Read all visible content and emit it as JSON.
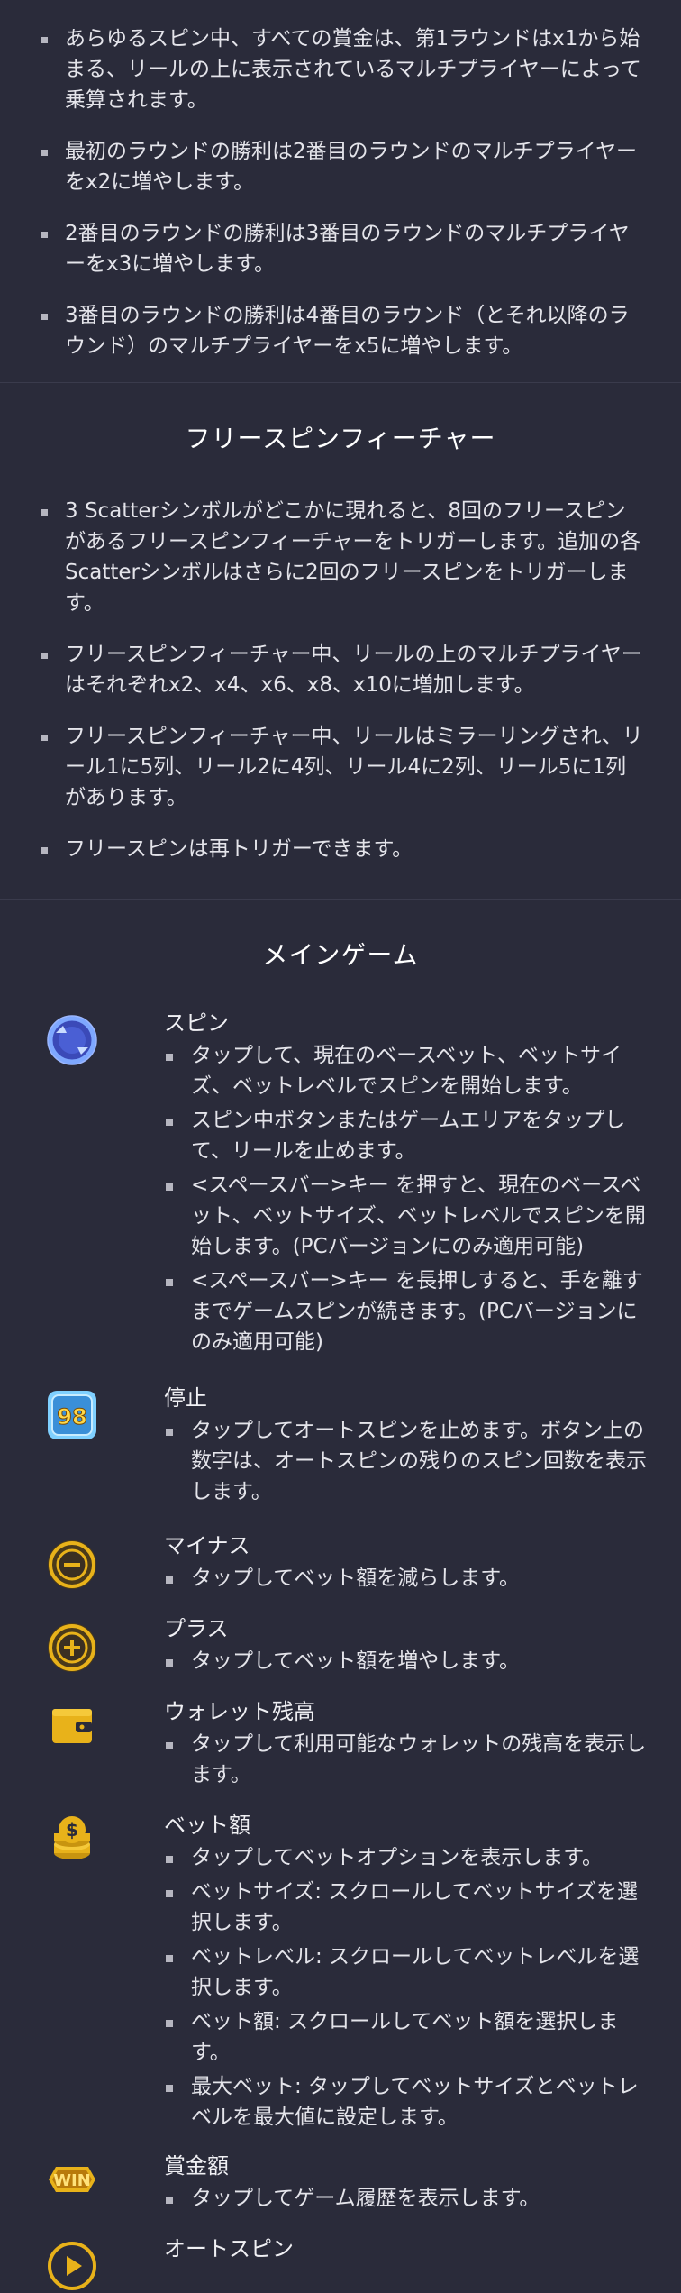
{
  "multiplier_rules": [
    "あらゆるスピン中、すべての賞金は、第1ラウンドはx1から始まる、リールの上に表示されているマルチプライヤーによって乗算されます。",
    "最初のラウンドの勝利は2番目のラウンドのマルチプライヤーをx2に増やします。",
    "2番目のラウンドの勝利は3番目のラウンドのマルチプライヤーをx3に増やします。",
    "3番目のラウンドの勝利は4番目のラウンド（とそれ以降のラウンド）のマルチプライヤーをx5に増やします。"
  ],
  "free_spins": {
    "title": "フリースピンフィーチャー",
    "items": [
      "3 Scatterシンボルがどこかに現れると、8回のフリースピンがあるフリースピンフィーチャーをトリガーします。追加の各Scatterシンボルはさらに2回のフリースピンをトリガーします。",
      "フリースピンフィーチャー中、リールの上のマルチプライヤーはそれぞれx2、x4、x6、x8、x10に増加します。",
      "フリースピンフィーチャー中、リールはミラーリングされ、リール1に5列、リール2に4列、リール4に2列、リール5に1列があります。",
      "フリースピンは再トリガーできます。"
    ]
  },
  "main_game": {
    "title": "メインゲーム",
    "items": [
      {
        "icon": "spin-icon",
        "title": "スピン",
        "bullets": [
          "タップして、現在のベースベット、ベットサイズ、ベットレベルでスピンを開始します。",
          "スピン中ボタンまたはゲームエリアをタップして、リールを止めます。",
          "<スペースバー>キー を押すと、現在のベースベット、ベットサイズ、ベットレベルでスピンを開始します。(PCバージョンにのみ適用可能)",
          "<スペースバー>キー を長押しすると、手を離すまでゲームスピンが続きます。(PCバージョンにのみ適用可能)"
        ]
      },
      {
        "icon": "stop-autospin-icon",
        "icon_text": "98",
        "title": "停止",
        "bullets": [
          "タップしてオートスピンを止めます。ボタン上の数字は、オートスピンの残りのスピン回数を表示します。"
        ]
      },
      {
        "icon": "minus-icon",
        "title": "マイナス",
        "bullets": [
          "タップしてベット額を減らします。"
        ]
      },
      {
        "icon": "plus-icon",
        "title": "プラス",
        "bullets": [
          "タップしてベット額を増やします。"
        ]
      },
      {
        "icon": "wallet-icon",
        "title": "ウォレット残高",
        "bullets": [
          "タップして利用可能なウォレットの残高を表示します。"
        ]
      },
      {
        "icon": "coins-icon",
        "title": "ベット額",
        "bullets": [
          "タップしてベットオプションを表示します。",
          "ベットサイズ: スクロールしてベットサイズを選択します。",
          "ベットレベル: スクロールしてベットレベルを選択します。",
          "ベット額: スクロールしてベット額を選択します。",
          "最大ベット: タップしてベットサイズとベットレベルを最大値に設定します。"
        ]
      },
      {
        "icon": "win-icon",
        "icon_text": "WIN",
        "title": "賞金額",
        "bullets": [
          "タップしてゲーム履歴を表示します。"
        ]
      },
      {
        "icon": "autospin-play-icon",
        "title": "オートスピン",
        "bullets": []
      }
    ]
  },
  "colors": {
    "background": "#2a2b3a",
    "icon_gold": "#e8b21a",
    "icon_blue": "#5a7be8"
  }
}
